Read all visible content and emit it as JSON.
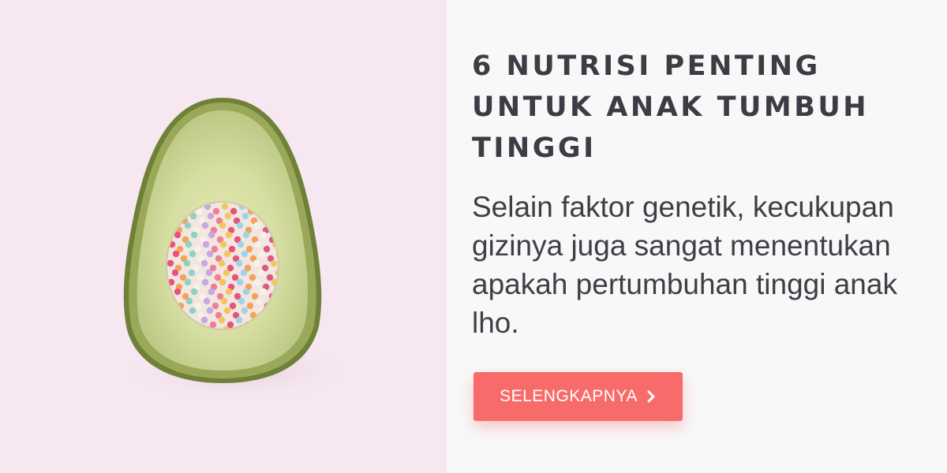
{
  "banner": {
    "title": "6 NUTRISI PENTING UNTUK ANAK TUMBUH TINGGI",
    "description": "Selain faktor genetik, kecukupan gizinya juga sangat menentukan apakah pertumbuhan tinggi anak lho.",
    "cta_label": "SELENGKAPNYA",
    "cta_icon": "chevron-right-icon",
    "image": "avocado-half-with-sprinkles-photo"
  },
  "colors": {
    "image_background": "#f7e7f0",
    "panel_background": "#f8f8f9",
    "text": "#3c3c44",
    "button": "#f86b6b",
    "button_text": "#ffffff"
  }
}
